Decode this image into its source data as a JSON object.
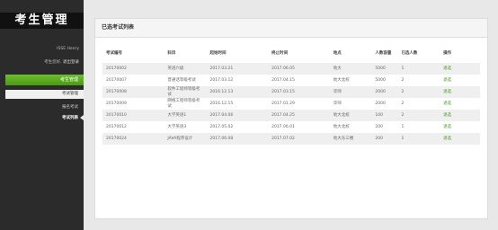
{
  "app": {
    "logo": "考生管理"
  },
  "user": {
    "id_line": "ISSE Henry",
    "greeting": "考生您好",
    "logout": "退出登录"
  },
  "nav": {
    "section": "考生管理",
    "items": [
      {
        "label": "考试管理"
      },
      {
        "label": "报名考试"
      },
      {
        "label": "考试列表"
      }
    ]
  },
  "panel": {
    "title": "已选考试列表"
  },
  "table": {
    "headers": [
      "考试编号",
      "科目",
      "起始时间",
      "终止时间",
      "地点",
      "人数容量",
      "已选人数",
      "操作"
    ],
    "rows": [
      {
        "id": "20170002",
        "subject": "英语六级",
        "start": "2017.03.21",
        "end": "2017.06.05",
        "location": "地大",
        "capacity": "5000",
        "selected": "1",
        "action": "退选"
      },
      {
        "id": "20170007",
        "subject": "普通话等级考试",
        "start": "2017.03.12",
        "end": "2017.04.15",
        "location": "地大北校",
        "capacity": "5000",
        "selected": "2",
        "action": "退选"
      },
      {
        "id": "20170008",
        "subject": "软件工程师等级考试",
        "start": "2016.12.13",
        "end": "2017.03.15",
        "location": "华师",
        "capacity": "2000",
        "selected": "2",
        "action": "退选"
      },
      {
        "id": "20170009",
        "subject": "网络工程师等级考试",
        "start": "2016.12.15",
        "end": "2017.01.29",
        "location": "华师",
        "capacity": "2000",
        "selected": "2",
        "action": "退选"
      },
      {
        "id": "20170010",
        "subject": "大学英语1",
        "start": "2017.04.06",
        "end": "2017.04.25",
        "location": "地大北校",
        "capacity": "100",
        "selected": "2",
        "action": "退选"
      },
      {
        "id": "20170012",
        "subject": "大学英语3",
        "start": "2017.05.02",
        "end": "2017.06.01",
        "location": "地大北校",
        "capacity": "200",
        "selected": "1",
        "action": "退选"
      },
      {
        "id": "20170024",
        "subject": "JAVA程序设计",
        "start": "2017.06.08",
        "end": "2017.07.02",
        "location": "地大东三楼",
        "capacity": "200",
        "selected": "1",
        "action": "退选"
      }
    ]
  }
}
